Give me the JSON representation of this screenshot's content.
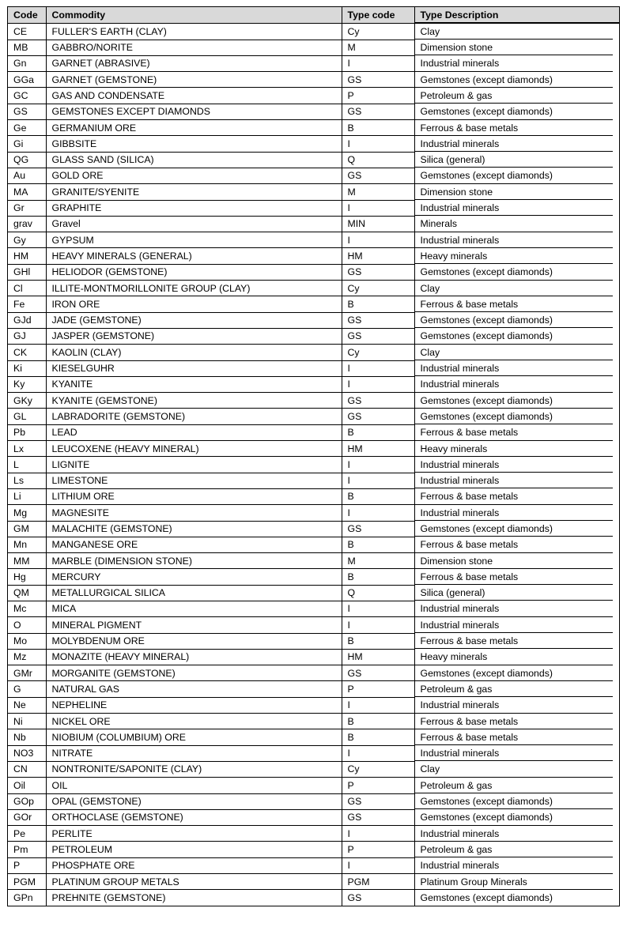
{
  "table": {
    "columns": [
      {
        "key": "code",
        "label": "Code"
      },
      {
        "key": "commodity",
        "label": "Commodity"
      },
      {
        "key": "type_code",
        "label": "Type code"
      },
      {
        "key": "type_description",
        "label": "Type Description"
      }
    ],
    "header_background": "#d9d9d9",
    "border_color": "#000000",
    "row_count": 57,
    "rows": [
      {
        "code": "CE",
        "commodity": "FULLER'S EARTH (CLAY)",
        "type_code": "Cy",
        "type_description": "Clay"
      },
      {
        "code": "MB",
        "commodity": "GABBRO/NORITE",
        "type_code": "M",
        "type_description": "Dimension stone"
      },
      {
        "code": "Gn",
        "commodity": "GARNET (ABRASIVE)",
        "type_code": "I",
        "type_description": "Industrial minerals"
      },
      {
        "code": "GGa",
        "commodity": "GARNET (GEMSTONE)",
        "type_code": "GS",
        "type_description": "Gemstones (except diamonds)"
      },
      {
        "code": "GC",
        "commodity": "GAS AND CONDENSATE",
        "type_code": "P",
        "type_description": "Petroleum & gas"
      },
      {
        "code": "GS",
        "commodity": "GEMSTONES EXCEPT DIAMONDS",
        "type_code": "GS",
        "type_description": "Gemstones (except diamonds)"
      },
      {
        "code": "Ge",
        "commodity": "GERMANIUM ORE",
        "type_code": "B",
        "type_description": "Ferrous & base metals"
      },
      {
        "code": "Gi",
        "commodity": "GIBBSITE",
        "type_code": "I",
        "type_description": "Industrial minerals"
      },
      {
        "code": "QG",
        "commodity": "GLASS SAND (SILICA)",
        "type_code": "Q",
        "type_description": "Silica (general)"
      },
      {
        "code": "Au",
        "commodity": "GOLD ORE",
        "type_code": "GS",
        "type_description": "Gemstones (except diamonds)"
      },
      {
        "code": "MA",
        "commodity": "GRANITE/SYENITE",
        "type_code": "M",
        "type_description": "Dimension stone"
      },
      {
        "code": "Gr",
        "commodity": "GRAPHITE",
        "type_code": "I",
        "type_description": "Industrial minerals"
      },
      {
        "code": "grav",
        "commodity": "Gravel",
        "type_code": "MIN",
        "type_description": "Minerals"
      },
      {
        "code": "Gy",
        "commodity": "GYPSUM",
        "type_code": "I",
        "type_description": "Industrial minerals"
      },
      {
        "code": "HM",
        "commodity": "HEAVY MINERALS (GENERAL)",
        "type_code": "HM",
        "type_description": "Heavy minerals"
      },
      {
        "code": "GHl",
        "commodity": "HELIODOR (GEMSTONE)",
        "type_code": "GS",
        "type_description": "Gemstones (except diamonds)"
      },
      {
        "code": "Cl",
        "commodity": "ILLITE-MONTMORILLONITE GROUP (CLAY)",
        "type_code": "Cy",
        "type_description": "Clay"
      },
      {
        "code": "Fe",
        "commodity": "IRON ORE",
        "type_code": "B",
        "type_description": "Ferrous & base metals"
      },
      {
        "code": "GJd",
        "commodity": "JADE (GEMSTONE)",
        "type_code": "GS",
        "type_description": "Gemstones (except diamonds)"
      },
      {
        "code": "GJ",
        "commodity": "JASPER (GEMSTONE)",
        "type_code": "GS",
        "type_description": "Gemstones (except diamonds)"
      },
      {
        "code": "CK",
        "commodity": "KAOLIN (CLAY)",
        "type_code": "Cy",
        "type_description": "Clay"
      },
      {
        "code": "Ki",
        "commodity": "KIESELGUHR",
        "type_code": "I",
        "type_description": "Industrial minerals"
      },
      {
        "code": "Ky",
        "commodity": "KYANITE",
        "type_code": "I",
        "type_description": "Industrial minerals"
      },
      {
        "code": "GKy",
        "commodity": "KYANITE (GEMSTONE)",
        "type_code": "GS",
        "type_description": "Gemstones (except diamonds)"
      },
      {
        "code": "GL",
        "commodity": "LABRADORITE (GEMSTONE)",
        "type_code": "GS",
        "type_description": "Gemstones (except diamonds)"
      },
      {
        "code": "Pb",
        "commodity": "LEAD",
        "type_code": "B",
        "type_description": "Ferrous & base metals"
      },
      {
        "code": "Lx",
        "commodity": "LEUCOXENE (HEAVY MINERAL)",
        "type_code": "HM",
        "type_description": "Heavy minerals"
      },
      {
        "code": "L",
        "commodity": "LIGNITE",
        "type_code": "I",
        "type_description": "Industrial minerals"
      },
      {
        "code": "Ls",
        "commodity": "LIMESTONE",
        "type_code": "I",
        "type_description": "Industrial minerals"
      },
      {
        "code": "Li",
        "commodity": "LITHIUM ORE",
        "type_code": "B",
        "type_description": "Ferrous & base metals"
      },
      {
        "code": "Mg",
        "commodity": "MAGNESITE",
        "type_code": "I",
        "type_description": "Industrial minerals"
      },
      {
        "code": "GM",
        "commodity": "MALACHITE (GEMSTONE)",
        "type_code": "GS",
        "type_description": "Gemstones (except diamonds)"
      },
      {
        "code": "Mn",
        "commodity": "MANGANESE ORE",
        "type_code": "B",
        "type_description": "Ferrous & base metals"
      },
      {
        "code": "MM",
        "commodity": "MARBLE (DIMENSION STONE)",
        "type_code": "M",
        "type_description": "Dimension stone"
      },
      {
        "code": "Hg",
        "commodity": "MERCURY",
        "type_code": "B",
        "type_description": "Ferrous & base metals"
      },
      {
        "code": "QM",
        "commodity": "METALLURGICAL SILICA",
        "type_code": "Q",
        "type_description": "Silica (general)"
      },
      {
        "code": "Mc",
        "commodity": "MICA",
        "type_code": "I",
        "type_description": "Industrial minerals"
      },
      {
        "code": "O",
        "commodity": "MINERAL PIGMENT",
        "type_code": "I",
        "type_description": "Industrial minerals"
      },
      {
        "code": "Mo",
        "commodity": "MOLYBDENUM ORE",
        "type_code": "B",
        "type_description": "Ferrous & base metals"
      },
      {
        "code": "Mz",
        "commodity": "MONAZITE (HEAVY MINERAL)",
        "type_code": "HM",
        "type_description": "Heavy minerals"
      },
      {
        "code": "GMr",
        "commodity": "MORGANITE (GEMSTONE)",
        "type_code": "GS",
        "type_description": "Gemstones (except diamonds)"
      },
      {
        "code": "G",
        "commodity": "NATURAL GAS",
        "type_code": "P",
        "type_description": "Petroleum & gas"
      },
      {
        "code": "Ne",
        "commodity": "NEPHELINE",
        "type_code": "I",
        "type_description": "Industrial minerals"
      },
      {
        "code": "Ni",
        "commodity": "NICKEL ORE",
        "type_code": "B",
        "type_description": "Ferrous & base metals"
      },
      {
        "code": "Nb",
        "commodity": "NIOBIUM (COLUMBIUM) ORE",
        "type_code": "B",
        "type_description": "Ferrous & base metals"
      },
      {
        "code": "NO3",
        "commodity": "NITRATE",
        "type_code": "I",
        "type_description": "Industrial minerals"
      },
      {
        "code": "CN",
        "commodity": "NONTRONITE/SAPONITE (CLAY)",
        "type_code": "Cy",
        "type_description": "Clay"
      },
      {
        "code": "Oil",
        "commodity": "OIL",
        "type_code": "P",
        "type_description": "Petroleum & gas"
      },
      {
        "code": "GOp",
        "commodity": "OPAL (GEMSTONE)",
        "type_code": "GS",
        "type_description": "Gemstones (except diamonds)"
      },
      {
        "code": "GOr",
        "commodity": "ORTHOCLASE (GEMSTONE)",
        "type_code": "GS",
        "type_description": "Gemstones (except diamonds)"
      },
      {
        "code": "Pe",
        "commodity": "PERLITE",
        "type_code": "I",
        "type_description": "Industrial minerals"
      },
      {
        "code": "Pm",
        "commodity": "PETROLEUM",
        "type_code": "P",
        "type_description": "Petroleum & gas"
      },
      {
        "code": "P",
        "commodity": "PHOSPHATE ORE",
        "type_code": "I",
        "type_description": "Industrial minerals"
      },
      {
        "code": "PGM",
        "commodity": "PLATINUM GROUP METALS",
        "type_code": "PGM",
        "type_description": "Platinum Group Minerals"
      },
      {
        "code": "GPn",
        "commodity": "PREHNITE (GEMSTONE)",
        "type_code": "GS",
        "type_description": "Gemstones (except diamonds)"
      }
    ]
  }
}
